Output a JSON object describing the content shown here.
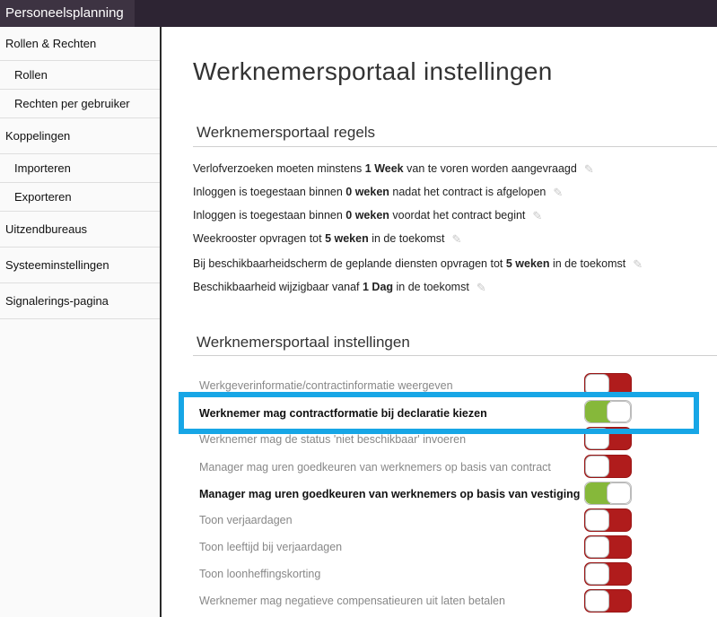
{
  "app": {
    "title": "Personeelsplanning"
  },
  "sidebar": {
    "items": [
      {
        "label": "Rollen & Rechten"
      },
      {
        "label": "Rollen"
      },
      {
        "label": "Rechten per gebruiker"
      },
      {
        "label": "Koppelingen"
      },
      {
        "label": "Importeren"
      },
      {
        "label": "Exporteren"
      },
      {
        "label": "Uitzendbureaus"
      },
      {
        "label": "Systeeminstellingen"
      },
      {
        "label": "Signalerings-pagina"
      }
    ]
  },
  "page": {
    "title": "Werknemersportaal instellingen"
  },
  "rules_section": {
    "title": "Werknemersportaal regels",
    "rules": [
      {
        "pre": "Verlofverzoeken moeten minstens ",
        "value": "1 Week",
        "post": " van te voren worden aangevraagd"
      },
      {
        "pre": "Inloggen is toegestaan binnen ",
        "value": "0 weken",
        "post": " nadat het contract is afgelopen"
      },
      {
        "pre": "Inloggen is toegestaan binnen ",
        "value": "0 weken",
        "post": " voordat het contract begint"
      },
      {
        "pre": "Weekrooster opvragen tot ",
        "value": "5 weken",
        "post": " in de toekomst"
      },
      {
        "pre": "Bij beschikbaarheidscherm de geplande diensten opvragen tot ",
        "value": "5 weken",
        "post": " in de toekomst"
      },
      {
        "pre": "Beschikbaarheid wijzigbaar vanaf ",
        "value": "1 Dag",
        "post": " in de toekomst"
      }
    ]
  },
  "settings_section": {
    "title": "Werknemersportaal instellingen",
    "settings": [
      {
        "label": "Werkgeverinformatie/contractinformatie weergeven",
        "enabled": false
      },
      {
        "label": "Werknemer mag contractformatie bij declaratie kiezen",
        "enabled": true
      },
      {
        "label": "Werknemer mag de status 'niet beschikbaar' invoeren",
        "enabled": false
      },
      {
        "label": "Manager mag uren goedkeuren van werknemers op basis van contract",
        "enabled": false
      },
      {
        "label": "Manager mag uren goedkeuren van werknemers op basis van vestiging",
        "enabled": true
      },
      {
        "label": "Toon verjaardagen",
        "enabled": false
      },
      {
        "label": "Toon leeftijd bij verjaardagen",
        "enabled": false
      },
      {
        "label": "Toon loonheffingskorting",
        "enabled": false
      },
      {
        "label": "Werknemer mag negatieve compensatieuren uit laten betalen",
        "enabled": false
      }
    ]
  },
  "colors": {
    "toggle_on": "#86b83a",
    "toggle_off": "#b01c1c",
    "highlight": "#17a6e6",
    "topbar": "#2d2433"
  },
  "icons": {
    "edit": "pencil-icon"
  }
}
